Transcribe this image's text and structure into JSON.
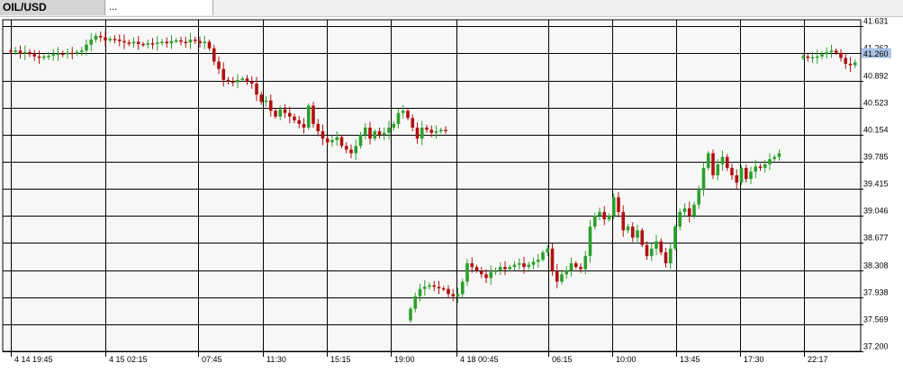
{
  "tabs": [
    {
      "label": "OIL/USD",
      "active": true
    },
    {
      "label": "...",
      "active": false
    }
  ],
  "colors": {
    "up": "#2ca02c",
    "down": "#b01010",
    "grid": "#000000",
    "plot_bg": "#f7f7f7",
    "price_marker_bg": "#a9c3e8"
  },
  "chart_data": {
    "type": "candlestick",
    "symbol": "OIL/USD",
    "ylim": [
      37.2,
      41.72
    ],
    "y_ticks": [
      "41.631",
      "41.262",
      "40.892",
      "40.523",
      "40.154",
      "39.785",
      "39.415",
      "39.046",
      "38.677",
      "38.308",
      "37.938",
      "37.569",
      "37.200"
    ],
    "y_tick_values": [
      41.631,
      41.262,
      40.892,
      40.523,
      40.154,
      39.785,
      39.415,
      39.046,
      38.677,
      38.308,
      37.938,
      37.569,
      37.2
    ],
    "x_tick_labels": [
      "4 14 19:45",
      "4 15 02:15",
      "07:45",
      "11:30",
      "15:15",
      "19:00",
      "4 18 00:45",
      "06:15",
      "10:00",
      "13:45",
      "17:30",
      "22:17"
    ],
    "x_tick_positions": [
      12,
      117,
      220,
      292,
      363,
      434,
      507,
      609,
      680,
      751,
      822,
      893
    ],
    "last_price": "41.260",
    "last_value": 41.26,
    "segments": [
      {
        "start_x": 12,
        "step": 5.25,
        "open": 41.3,
        "closes": [
          41.29,
          41.3,
          41.26,
          41.28,
          41.25,
          41.22,
          41.2,
          41.22,
          41.23,
          41.25,
          41.26,
          41.25,
          41.27,
          41.26,
          41.28,
          41.3,
          41.38,
          41.45,
          41.5,
          41.48,
          41.44,
          41.46,
          41.45,
          41.43,
          41.41,
          41.4,
          41.42,
          41.39,
          41.38,
          41.4,
          41.39,
          41.41,
          41.42,
          41.4,
          41.43,
          41.44,
          41.42,
          41.41,
          41.45,
          41.43,
          41.4,
          41.42,
          41.33,
          41.15,
          41.05,
          40.9,
          40.88,
          40.87,
          40.9,
          40.92,
          40.88,
          40.85,
          40.7,
          40.6,
          40.62,
          40.48,
          40.4,
          40.5,
          40.45,
          40.4,
          40.35,
          40.3,
          40.25,
          40.55,
          40.3,
          40.2,
          40.1,
          40.05,
          40.08,
          40.12,
          40.0,
          39.95,
          39.9,
          40.0,
          40.15,
          40.25,
          40.1,
          40.2,
          40.15,
          40.18,
          40.25,
          40.3,
          40.45,
          40.48,
          40.38,
          40.25,
          40.1,
          40.25,
          40.22,
          40.18,
          40.2,
          40.22,
          40.21
        ]
      },
      {
        "start_x": 456,
        "step": 5.25,
        "open": 37.62,
        "closes": [
          37.78,
          37.95,
          38.05,
          38.08,
          38.1,
          38.08,
          38.06,
          38.05,
          37.98,
          37.95,
          37.98,
          38.15,
          38.4,
          38.35,
          38.3,
          38.25,
          38.2,
          38.28,
          38.3,
          38.35,
          38.32,
          38.35,
          38.38,
          38.4,
          38.35,
          38.38,
          38.42,
          38.45,
          38.55,
          38.6,
          38.3,
          38.15,
          38.25,
          38.3,
          38.4,
          38.35,
          38.32,
          38.5,
          38.9,
          39.05,
          39.1,
          39.0,
          39.05,
          39.3,
          39.1,
          38.85,
          38.9,
          38.75,
          38.85,
          38.65,
          38.5,
          38.6,
          38.7,
          38.55,
          38.4,
          38.6,
          38.9,
          39.1,
          39.15,
          39.05,
          39.2,
          39.4,
          39.7,
          39.9,
          39.6,
          39.75,
          39.85,
          39.7,
          39.6,
          39.5,
          39.7,
          39.55,
          39.65,
          39.72,
          39.7,
          39.75,
          39.82,
          39.85,
          39.9
        ]
      },
      {
        "start_x": 892,
        "step": 5.25,
        "open": 41.2,
        "closes": [
          41.22,
          41.2,
          41.21,
          41.22,
          41.25,
          41.28,
          41.3,
          41.27,
          41.2,
          41.12,
          41.1,
          41.14
        ]
      }
    ]
  }
}
